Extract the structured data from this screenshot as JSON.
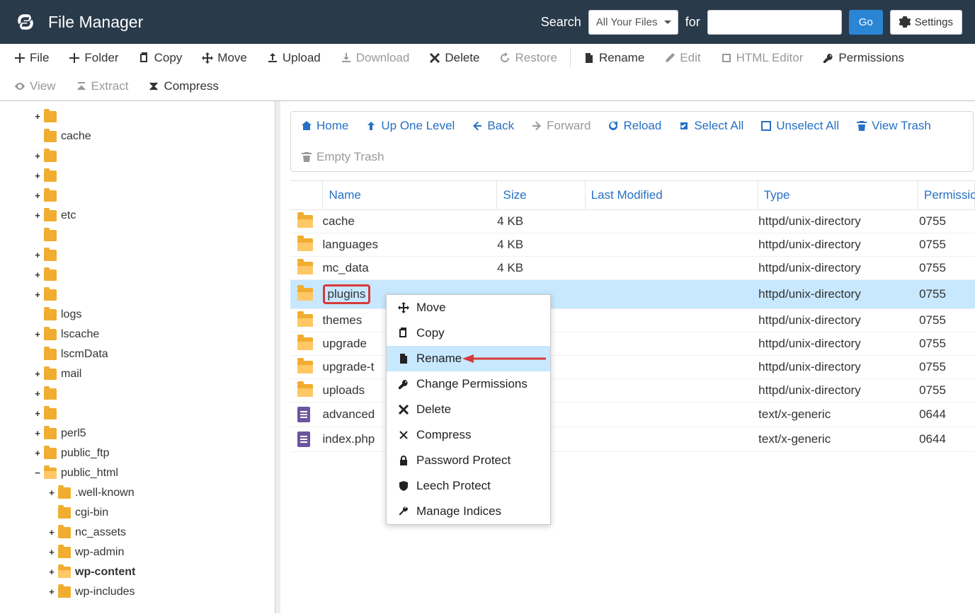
{
  "header": {
    "title": "File Manager",
    "search_label": "Search",
    "for_label": "for",
    "select_value": "All Your Files",
    "go_label": "Go",
    "settings_label": "Settings"
  },
  "toolbar": {
    "file": "File",
    "folder": "Folder",
    "copy": "Copy",
    "move": "Move",
    "upload": "Upload",
    "download": "Download",
    "delete": "Delete",
    "restore": "Restore",
    "rename": "Rename",
    "edit": "Edit",
    "html_editor": "HTML Editor",
    "permissions": "Permissions",
    "view": "View",
    "extract": "Extract",
    "compress": "Compress"
  },
  "fp_toolbar": {
    "home": "Home",
    "up_one": "Up One Level",
    "back": "Back",
    "forward": "Forward",
    "reload": "Reload",
    "select_all": "Select All",
    "unselect_all": "Unselect All",
    "view_trash": "View Trash",
    "empty_trash": "Empty Trash"
  },
  "columns": {
    "name": "Name",
    "size": "Size",
    "modified": "Last Modified",
    "type": "Type",
    "permissions": "Permissions"
  },
  "tree": [
    {
      "expand": "+",
      "label": "",
      "indent": 0
    },
    {
      "expand": "",
      "label": "cache",
      "indent": 0
    },
    {
      "expand": "+",
      "label": "",
      "indent": 0
    },
    {
      "expand": "+",
      "label": "",
      "indent": 0
    },
    {
      "expand": "+",
      "label": "",
      "indent": 0
    },
    {
      "expand": "+",
      "label": "etc",
      "indent": 0
    },
    {
      "expand": "",
      "label": "",
      "indent": 0
    },
    {
      "expand": "+",
      "label": "",
      "indent": 0
    },
    {
      "expand": "+",
      "label": "",
      "indent": 0
    },
    {
      "expand": "+",
      "label": "",
      "indent": 0
    },
    {
      "expand": "",
      "label": "logs",
      "indent": 0
    },
    {
      "expand": "+",
      "label": "lscache",
      "indent": 0
    },
    {
      "expand": "",
      "label": "lscmData",
      "indent": 0
    },
    {
      "expand": "+",
      "label": "mail",
      "indent": 0
    },
    {
      "expand": "+",
      "label": "",
      "indent": 0
    },
    {
      "expand": "+",
      "label": "",
      "indent": 0
    },
    {
      "expand": "+",
      "label": "perl5",
      "indent": 0
    },
    {
      "expand": "+",
      "label": "public_ftp",
      "indent": 0
    },
    {
      "expand": "−",
      "label": "public_html",
      "indent": 0,
      "open": true
    },
    {
      "expand": "+",
      "label": ".well-known",
      "indent": 1
    },
    {
      "expand": "",
      "label": "cgi-bin",
      "indent": 1
    },
    {
      "expand": "+",
      "label": "nc_assets",
      "indent": 1
    },
    {
      "expand": "+",
      "label": "wp-admin",
      "indent": 1
    },
    {
      "expand": "+",
      "label": "wp-content",
      "indent": 1,
      "bold": true,
      "open": true
    },
    {
      "expand": "+",
      "label": "wp-includes",
      "indent": 1
    }
  ],
  "files": [
    {
      "icon": "folder",
      "name": "cache",
      "size": "4 KB",
      "modified": "",
      "type": "httpd/unix-directory",
      "perm": "0755"
    },
    {
      "icon": "folder",
      "name": "languages",
      "size": "4 KB",
      "modified": "",
      "type": "httpd/unix-directory",
      "perm": "0755"
    },
    {
      "icon": "folder",
      "name": "mc_data",
      "size": "4 KB",
      "modified": "",
      "type": "httpd/unix-directory",
      "perm": "0755"
    },
    {
      "icon": "folder",
      "name": "plugins",
      "size": "",
      "modified": "",
      "type": "httpd/unix-directory",
      "perm": "0755",
      "selected": true,
      "highlight_name": true
    },
    {
      "icon": "folder",
      "name": "themes",
      "size": "",
      "modified": "",
      "type": "httpd/unix-directory",
      "perm": "0755"
    },
    {
      "icon": "folder",
      "name": "upgrade",
      "size": "",
      "modified": "",
      "type": "httpd/unix-directory",
      "perm": "0755"
    },
    {
      "icon": "folder",
      "name": "upgrade-t",
      "size": "",
      "modified": "",
      "type": "httpd/unix-directory",
      "perm": "0755"
    },
    {
      "icon": "folder",
      "name": "uploads",
      "size": "",
      "modified": "",
      "type": "httpd/unix-directory",
      "perm": "0755"
    },
    {
      "icon": "file",
      "name": "advanced",
      "size": "",
      "modified": "",
      "type": "text/x-generic",
      "perm": "0644"
    },
    {
      "icon": "file",
      "name": "index.php",
      "size": "",
      "modified": "",
      "type": "text/x-generic",
      "perm": "0644"
    }
  ],
  "context_menu": [
    {
      "icon": "move",
      "label": "Move"
    },
    {
      "icon": "copy",
      "label": "Copy"
    },
    {
      "icon": "rename",
      "label": "Rename",
      "highlight": true
    },
    {
      "icon": "key",
      "label": "Change Permissions"
    },
    {
      "icon": "x",
      "label": "Delete"
    },
    {
      "icon": "compress",
      "label": "Compress"
    },
    {
      "icon": "lock",
      "label": "Password Protect"
    },
    {
      "icon": "shield",
      "label": "Leech Protect"
    },
    {
      "icon": "wrench",
      "label": "Manage Indices"
    }
  ]
}
